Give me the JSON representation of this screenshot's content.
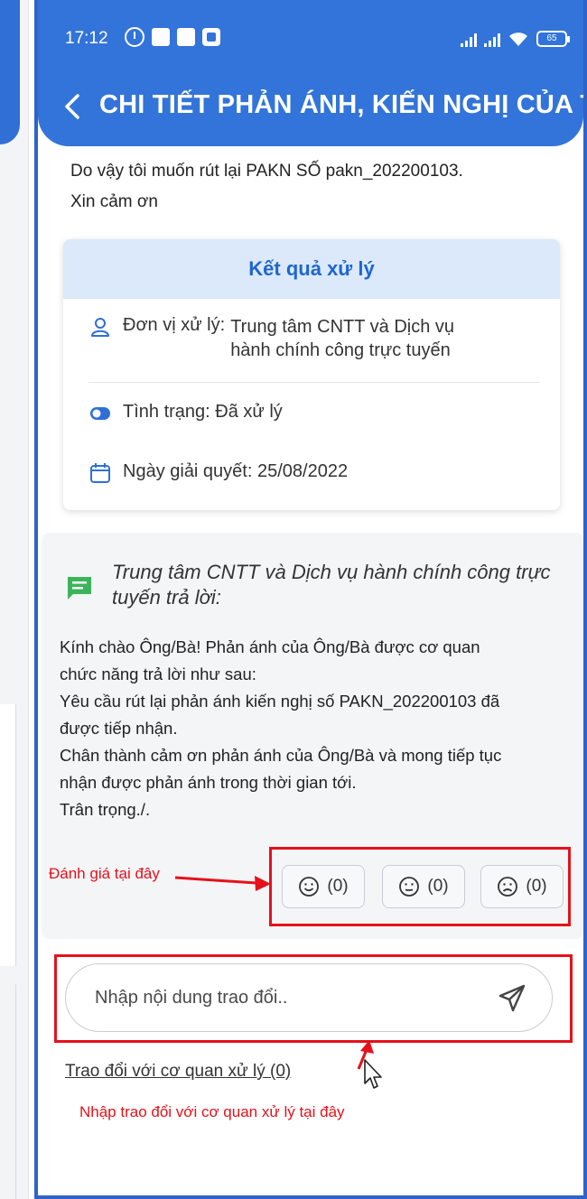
{
  "status_bar": {
    "time": "17:12",
    "battery": "65"
  },
  "header": {
    "title": "CHI TIẾT PHẢN ÁNH, KIẾN NGHỊ CỦA TÔI"
  },
  "content": {
    "line1": "Do vậy tôi muốn rút lại PAKN SỐ pakn_202200103.",
    "line2": "Xin cảm ơn"
  },
  "result_card": {
    "heading": "Kết quả xử lý",
    "unit_label": "Đơn vị xử lý:",
    "unit_value_line1": "Trung tâm CNTT và Dịch vụ",
    "unit_value_line2": "hành chính công trực tuyến",
    "status_text": "Tình trạng: Đã xử lý",
    "date_text": "Ngày giải quyết: 25/08/2022"
  },
  "reply": {
    "title_line1": "Trung tâm CNTT và Dịch vụ hành chính công trực",
    "title_line2": "tuyến trả lời:",
    "body": [
      "Kính chào Ông/Bà! Phản ánh của Ông/Bà được cơ quan",
      "chức năng trả lời như sau:",
      "Yêu cầu rút lại phản ánh kiến nghị số PAKN_202200103 đã",
      "được tiếp nhận.",
      "Chân thành cảm ơn phản ánh của Ông/Bà và mong tiếp tục",
      "nhận được phản ánh trong thời gian tới.",
      "Trân trọng./."
    ]
  },
  "rating": {
    "happy_count": "(0)",
    "neutral_count": "(0)",
    "sad_count": "(0)",
    "annotation": "Đánh giá tại đây"
  },
  "exchange": {
    "placeholder": "Nhập nội dung trao đổi..",
    "link_text": "Trao đổi với cơ quan xử lý (0)",
    "annotation": "Nhập trao đổi với cơ quan xử lý tại đây"
  },
  "colors": {
    "header_blue": "#3274d9",
    "accent_blue": "#1f66cf",
    "annotation_red": "#e5111a",
    "chat_icon_green": "#3bb55a"
  }
}
